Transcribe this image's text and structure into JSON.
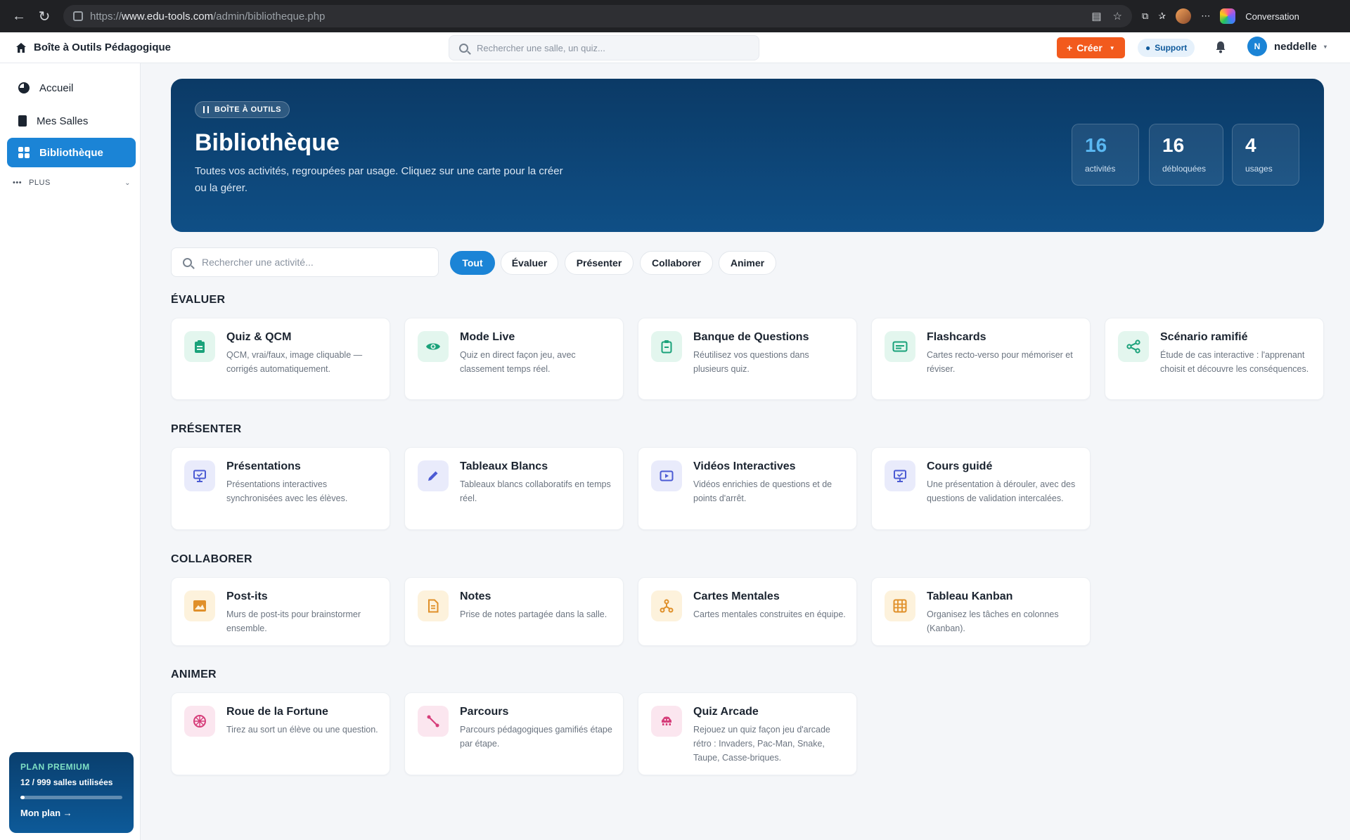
{
  "browser": {
    "url_prefix": "https://",
    "url_host": "www.edu-tools.com",
    "url_path": "/admin/bibliotheque.php",
    "profile_label": "Conversation"
  },
  "topbar": {
    "brand": "Boîte à Outils Pédagogique",
    "search_placeholder": "Rechercher une salle, un quiz...",
    "create_label": "Créer",
    "support_label": "Support",
    "user_initial": "N",
    "user_name": "neddelle"
  },
  "sidebar": {
    "items": [
      {
        "label": "Accueil",
        "icon": "pie-chart-icon"
      },
      {
        "label": "Mes Salles",
        "icon": "building-icon"
      },
      {
        "label": "Bibliothèque",
        "icon": "grid-icon"
      }
    ],
    "more_label": "PLUS",
    "premium": {
      "title": "PLAN PREMIUM",
      "usage": "12 / 999 salles utilisées",
      "usage_fraction": 0.012,
      "link": "Mon plan →"
    }
  },
  "hero": {
    "tag": "BOÎTE À OUTILS",
    "title": "Bibliothèque",
    "description": "Toutes vos activités, regroupées par usage. Cliquez sur une carte pour la créer ou la gérer.",
    "stats": [
      {
        "value": "16",
        "label": "activités"
      },
      {
        "value": "16",
        "label": "débloquées"
      },
      {
        "value": "4",
        "label": "usages"
      }
    ]
  },
  "filters": {
    "search_placeholder": "Rechercher une activité...",
    "chips": [
      "Tout",
      "Évaluer",
      "Présenter",
      "Collaborer",
      "Animer"
    ],
    "active": "Tout"
  },
  "sections": [
    {
      "title": "ÉVALUER",
      "cards": [
        {
          "title": "Quiz & QCM",
          "desc": "QCM, vrai/faux, image cliquable — corrigés automatiquement.",
          "icon": "clipboard-icon"
        },
        {
          "title": "Mode Live",
          "desc": "Quiz en direct façon jeu, avec classement temps réel.",
          "icon": "eye-icon"
        },
        {
          "title": "Banque de Questions",
          "desc": "Réutilisez vos questions dans plusieurs quiz.",
          "icon": "clipboard-list-icon"
        },
        {
          "title": "Flashcards",
          "desc": "Cartes recto-verso pour mémoriser et réviser.",
          "icon": "card-icon"
        },
        {
          "title": "Scénario ramifié",
          "desc": "Étude de cas interactive : l'apprenant choisit et découvre les conséquences.",
          "icon": "share-icon"
        }
      ]
    },
    {
      "title": "PRÉSENTER",
      "cards": [
        {
          "title": "Présentations",
          "desc": "Présentations interactives synchronisées avec les élèves.",
          "icon": "presentation-icon"
        },
        {
          "title": "Tableaux Blancs",
          "desc": "Tableaux blancs collaboratifs en temps réel.",
          "icon": "pencil-icon"
        },
        {
          "title": "Vidéos Interactives",
          "desc": "Vidéos enrichies de questions et de points d'arrêt.",
          "icon": "video-icon"
        },
        {
          "title": "Cours guidé",
          "desc": "Une présentation à dérouler, avec des questions de validation intercalées.",
          "icon": "presentation-check-icon"
        }
      ]
    },
    {
      "title": "COLLABORER",
      "cards": [
        {
          "title": "Post-its",
          "desc": "Murs de post-its pour brainstormer ensemble.",
          "icon": "image-icon"
        },
        {
          "title": "Notes",
          "desc": "Prise de notes partagée dans la salle.",
          "icon": "document-icon"
        },
        {
          "title": "Cartes Mentales",
          "desc": "Cartes mentales construites en équipe.",
          "icon": "mind-map-icon"
        },
        {
          "title": "Tableau Kanban",
          "desc": "Organisez les tâches en colonnes (Kanban).",
          "icon": "kanban-icon"
        }
      ]
    },
    {
      "title": "ANIMER",
      "cards": [
        {
          "title": "Roue de la Fortune",
          "desc": "Tirez au sort un élève ou une question.",
          "icon": "wheel-icon"
        },
        {
          "title": "Parcours",
          "desc": "Parcours pédagogiques gamifiés étape par étape.",
          "icon": "path-icon"
        },
        {
          "title": "Quiz Arcade",
          "desc": "Rejouez un quiz façon jeu d'arcade rétro : Invaders, Pac-Man, Snake, Taupe, Casse-briques.",
          "icon": "space-invader-icon"
        }
      ]
    }
  ]
}
